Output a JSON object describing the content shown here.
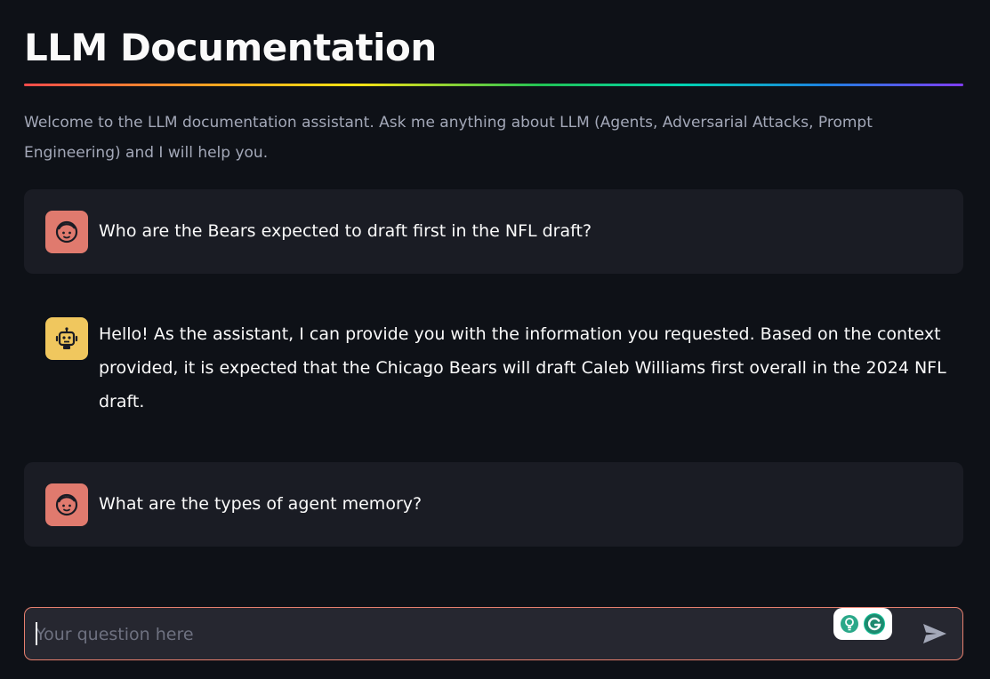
{
  "page": {
    "title": "LLM Documentation",
    "intro": "Welcome to the LLM documentation assistant. Ask me anything about LLM (Agents, Adversarial Attacks, Prompt Engineering) and I will help you."
  },
  "messages": [
    {
      "role": "user",
      "avatar_icon": "face-icon",
      "text": "Who are the Bears expected to draft first in the NFL draft?"
    },
    {
      "role": "assistant",
      "avatar_icon": "robot-icon",
      "text": "Hello! As the assistant, I can provide you with the information you requested. Based on the context provided, it is expected that the Chicago Bears will draft Caleb Williams first overall in the 2024 NFL draft."
    },
    {
      "role": "user",
      "avatar_icon": "face-icon",
      "text": "What are the types of agent memory?"
    }
  ],
  "chat_input": {
    "value": "",
    "placeholder": "Your question here",
    "send_icon": "send-icon",
    "extension_icons": [
      "lightbulb-icon",
      "grammarly-icon"
    ]
  },
  "colors": {
    "background": "#0e1117",
    "user_message_bg": "#1a1c24",
    "user_avatar": "#e07a6e",
    "assistant_avatar": "#f0c75e",
    "input_border": "#e7806f"
  }
}
